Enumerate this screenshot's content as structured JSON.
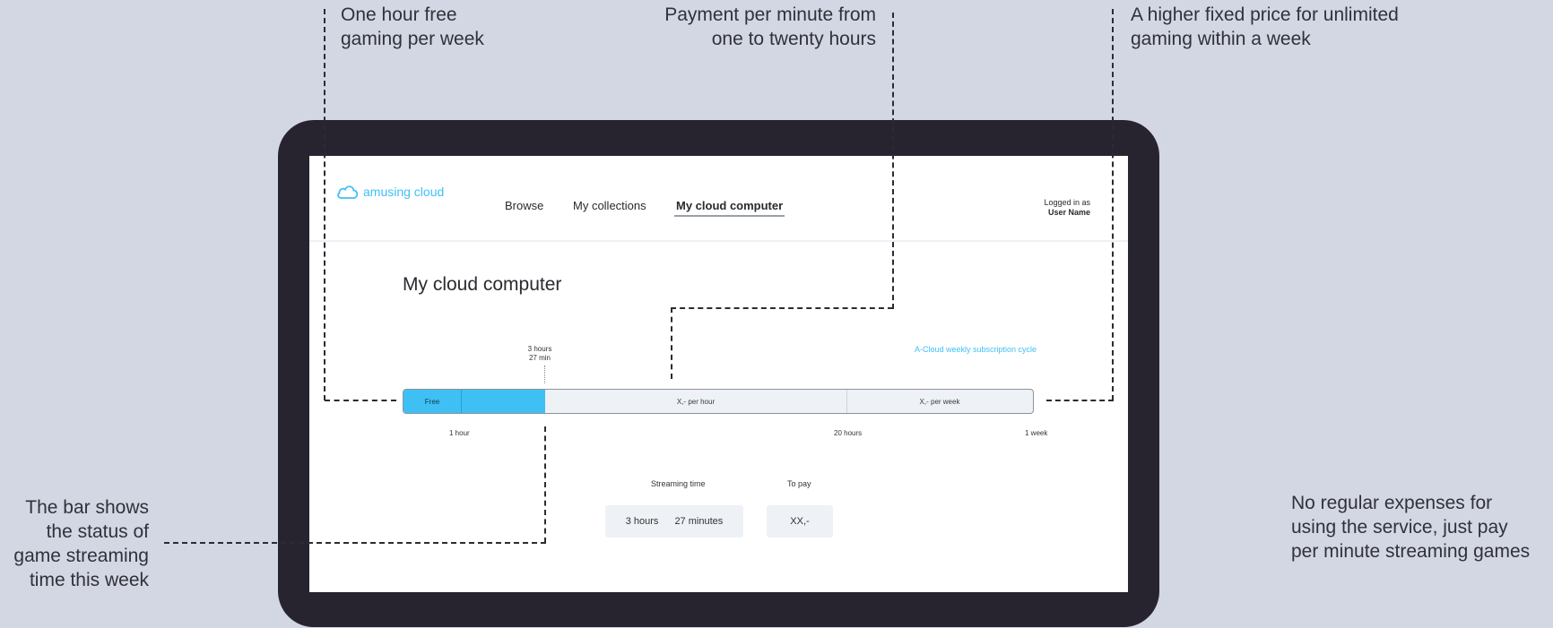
{
  "annotations": {
    "free_gaming": [
      "One hour free",
      "gaming per week"
    ],
    "per_minute": [
      "Payment per minute from",
      "one to twenty hours"
    ],
    "fixed_price": [
      "A higher fixed price for unlimited",
      "gaming within a week"
    ],
    "bar_status": [
      "The bar shows",
      "the status of",
      "game streaming",
      "time this week"
    ],
    "no_expenses": [
      "No regular expenses for",
      "using the service, just pay",
      "per minute streaming games"
    ]
  },
  "app": {
    "logo_text": "amusing cloud",
    "nav": [
      "Browse",
      "My collections",
      "My cloud computer"
    ],
    "active_nav": "My cloud computer",
    "login_label": "Logged in as",
    "user_name": "User Name",
    "page_title": "My cloud computer",
    "usage": {
      "marker_hours": "3 hours",
      "marker_min": "27 min",
      "cycle_label": "A-Cloud weekly subscription cycle",
      "segments": {
        "free": "Free",
        "per_hour": "X,- per hour",
        "per_week": "X,- per week"
      },
      "ticks": {
        "one_hour": "1 hour",
        "twenty_hours": "20 hours",
        "one_week": "1 week"
      }
    },
    "streaming": {
      "label": "Streaming time",
      "hours": "3 hours",
      "minutes": "27 minutes"
    },
    "payment": {
      "label": "To pay",
      "amount": "XX,-"
    }
  },
  "colors": {
    "background": "#d3d7e3",
    "device": "#272430",
    "accent": "#3fc0f5"
  },
  "icons": {
    "logo": "cloud-icon"
  }
}
